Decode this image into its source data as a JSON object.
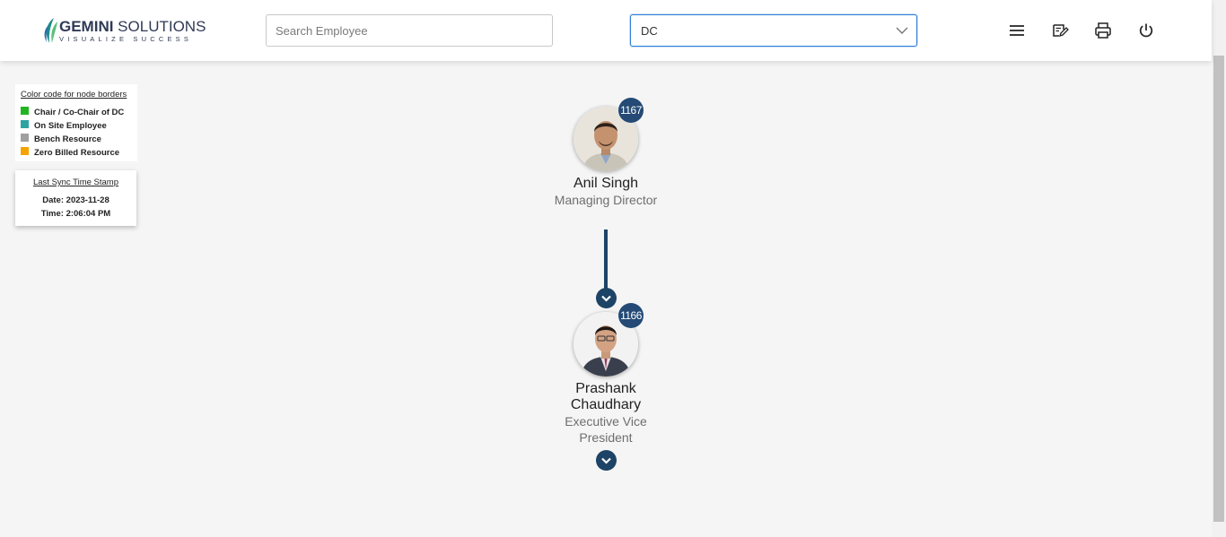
{
  "header": {
    "logo": {
      "brand_bold": "GEMINI",
      "brand_light": " SOLUTIONS",
      "tagline": "VISUALIZE SUCCESS"
    },
    "search": {
      "placeholder": "Search Employee",
      "value": ""
    },
    "dropdown": {
      "selected": "DC"
    },
    "actions": [
      {
        "name": "menu-icon"
      },
      {
        "name": "edit-note-icon"
      },
      {
        "name": "print-icon"
      },
      {
        "name": "power-icon"
      }
    ]
  },
  "legend": {
    "title": "Color code for node borders",
    "items": [
      {
        "label": "Chair / Co-Chair of DC",
        "color": "#22b522"
      },
      {
        "label": "On Site Employee",
        "color": "#2ea3a3"
      },
      {
        "label": "Bench Resource",
        "color": "#a0a0a0"
      },
      {
        "label": "Zero Billed Resource",
        "color": "#f5a300"
      }
    ]
  },
  "sync": {
    "title": "Last Sync Time Stamp",
    "date": "Date: 2023-11-28",
    "time": "Time: 2:06:04 PM"
  },
  "org": {
    "nodes": [
      {
        "id": "1167",
        "name": "Anil Singh",
        "title": "Managing Director"
      },
      {
        "id": "1166",
        "name": "Prashank Chaudhary",
        "title": "Executive Vice President"
      }
    ]
  },
  "colors": {
    "accent": "#244a75",
    "connector": "#1d4466",
    "dropdown_focus": "#2f7fd8"
  }
}
